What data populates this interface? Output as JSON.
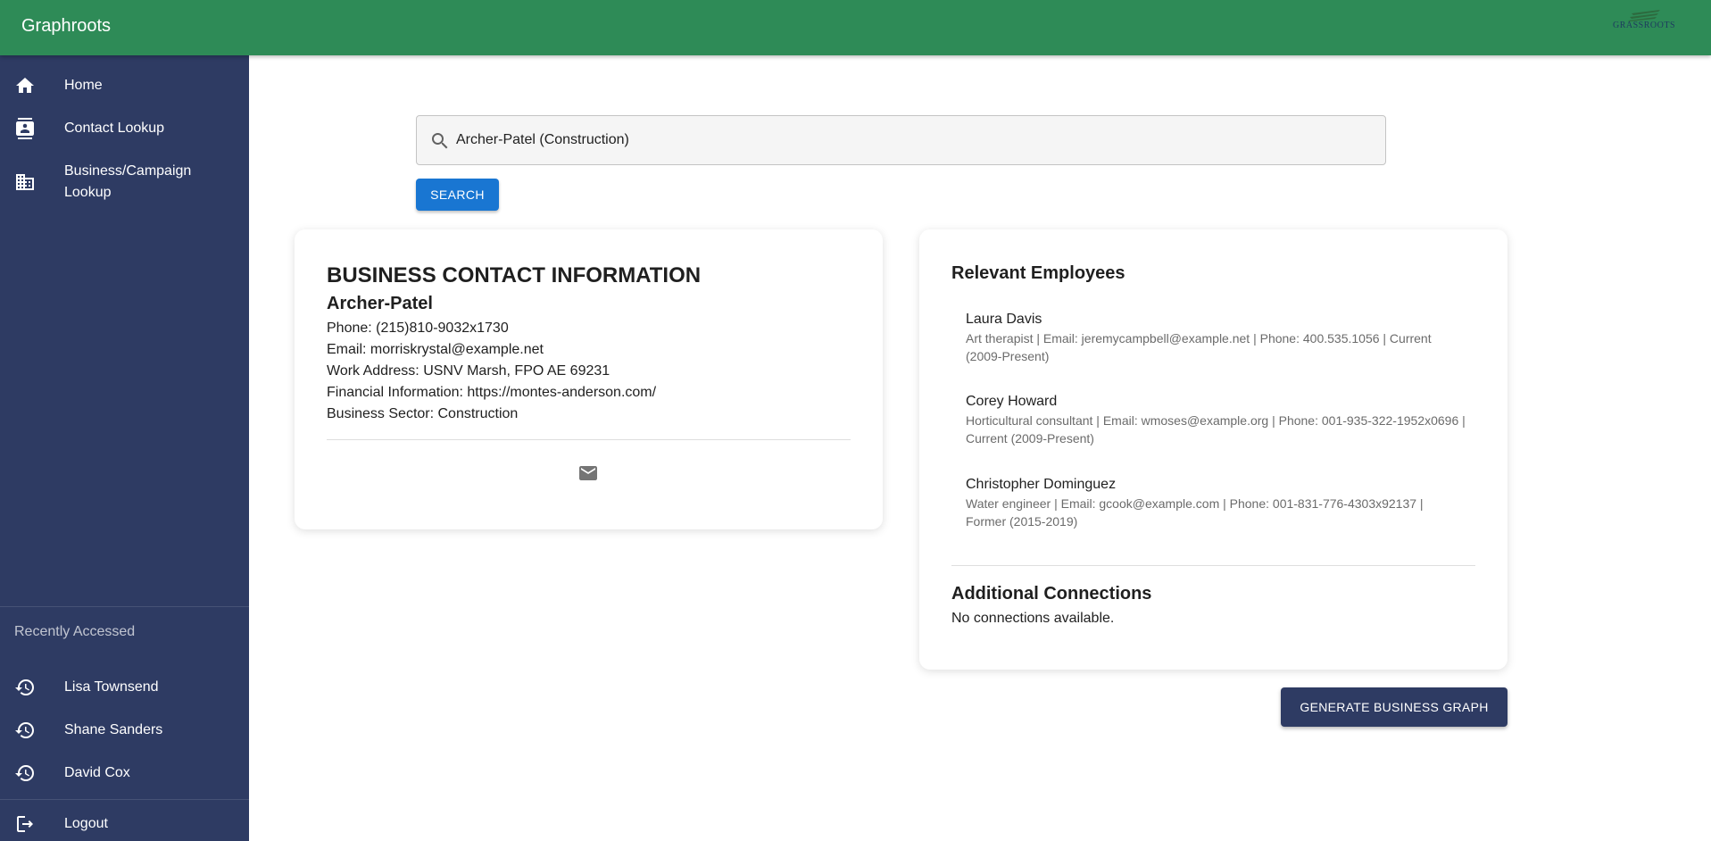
{
  "app": {
    "title": "Graphroots",
    "logo_text": "GRASSROOTS"
  },
  "sidebar": {
    "nav": [
      {
        "label": "Home",
        "icon": "home-icon"
      },
      {
        "label": "Contact Lookup",
        "icon": "contact-card-icon"
      },
      {
        "label": "Business/Campaign Lookup",
        "icon": "business-building-icon"
      }
    ],
    "recent_header": "Recently Accessed",
    "recent": [
      {
        "label": "Lisa Townsend",
        "icon": "history-icon"
      },
      {
        "label": "Shane Sanders",
        "icon": "history-icon"
      },
      {
        "label": "David Cox",
        "icon": "history-icon"
      }
    ],
    "logout": {
      "label": "Logout",
      "icon": "logout-icon"
    }
  },
  "search": {
    "value": "Archer-Patel (Construction)",
    "button_label": "SEARCH"
  },
  "business": {
    "heading": "BUSINESS CONTACT INFORMATION",
    "name": "Archer-Patel",
    "phone": "Phone: (215)810-9032x1730",
    "email": "Email: morriskrystal@example.net",
    "address": "Work Address: USNV Marsh, FPO AE 69231",
    "financial": "Financial Information: https://montes-anderson.com/",
    "sector": "Business Sector: Construction"
  },
  "employees": {
    "heading": "Relevant Employees",
    "items": [
      {
        "name": "Laura Davis",
        "detail": "Art therapist | Email: jeremycampbell@example.net | Phone: 400.535.1056 | Current (2009-Present)"
      },
      {
        "name": "Corey Howard",
        "detail": "Horticultural consultant | Email: wmoses@example.org | Phone: 001-935-322-1952x0696 | Current (2009-Present)"
      },
      {
        "name": "Christopher Dominguez",
        "detail": "Water engineer | Email: gcook@example.com | Phone: 001-831-776-4303x92137 | Former (2015-2019)"
      }
    ]
  },
  "connections": {
    "heading": "Additional Connections",
    "text": "No connections available."
  },
  "graph_button": "GENERATE BUSINESS GRAPH",
  "colors": {
    "appbar": "#2e8b57",
    "sidebar": "#2e3b63",
    "search_button": "#1976d2",
    "graph_button": "#2e3b63"
  }
}
